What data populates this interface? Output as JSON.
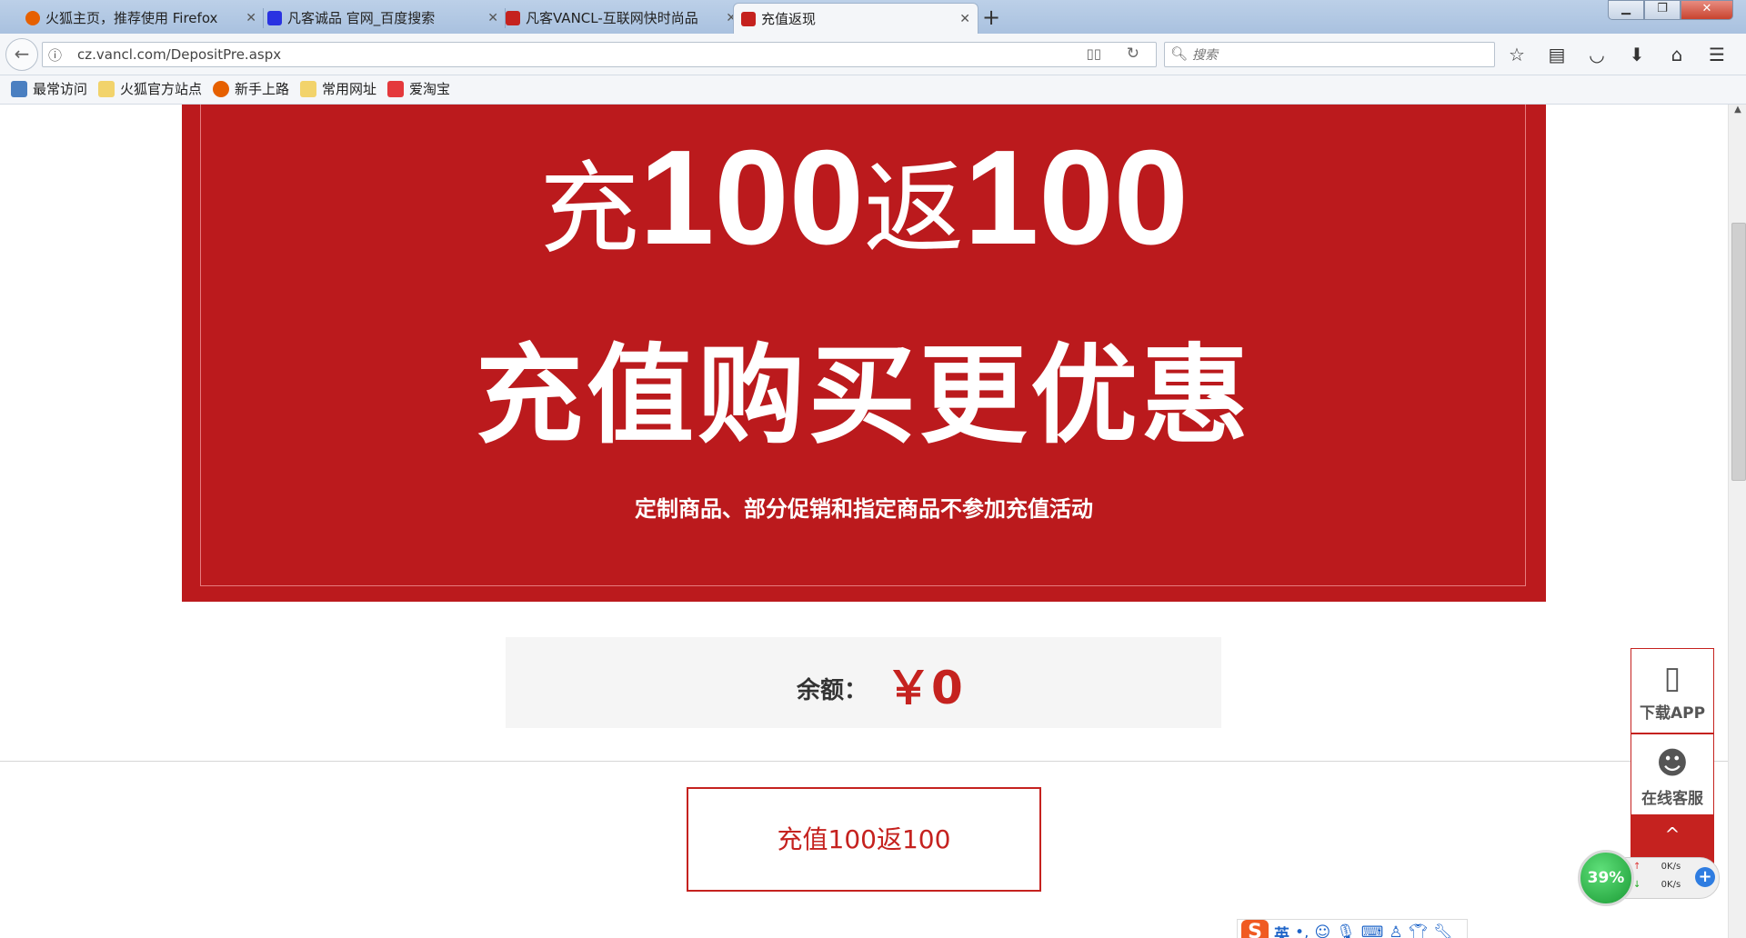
{
  "browser": {
    "tabs": [
      {
        "title": "火狐主页，推荐使用 Firefox",
        "favicon_color": "#e66000",
        "active": false
      },
      {
        "title": "凡客诚品 官网_百度搜索",
        "favicon_color": "#2932e1",
        "active": false
      },
      {
        "title": "凡客VANCL-互联网快时尚品",
        "favicon_color": "#c5221f",
        "active": false
      },
      {
        "title": "充值返现",
        "favicon_color": "#c5221f",
        "active": true
      }
    ],
    "new_tab_label": "+",
    "url": "cz.vancl.com/DepositPre.aspx",
    "search_placeholder": "搜索",
    "bookmarks": [
      {
        "label": "最常访问",
        "icon": "most-visited-icon",
        "color": "#4a7fc1"
      },
      {
        "label": "火狐官方站点",
        "icon": "folder-icon",
        "color": "#f2d36b"
      },
      {
        "label": "新手上路",
        "icon": "firefox-icon",
        "color": "#e66000"
      },
      {
        "label": "常用网址",
        "icon": "folder-icon",
        "color": "#f2d36b"
      },
      {
        "label": "爱淘宝",
        "icon": "taobao-icon",
        "color": "#e4393c"
      }
    ]
  },
  "banner": {
    "chong": "充",
    "amount1": "100",
    "fan": "返",
    "amount2": "100",
    "headline": "充值购买更优惠",
    "note": "定制商品、部分促销和指定商品不参加充值活动",
    "bg_color": "#bb1a1d"
  },
  "balance": {
    "label": "余额：",
    "amount": "￥0"
  },
  "topup_button": "充值100返100",
  "float_panel": {
    "app_label": "下载APP",
    "service_label": "在线客服",
    "top_label": "^"
  },
  "net_monitor": {
    "percent": "39%",
    "up_speed": "0K/s",
    "down_speed": "0K/s"
  },
  "ime": {
    "lang": "英"
  },
  "colors": {
    "accent": "#c5221f"
  }
}
